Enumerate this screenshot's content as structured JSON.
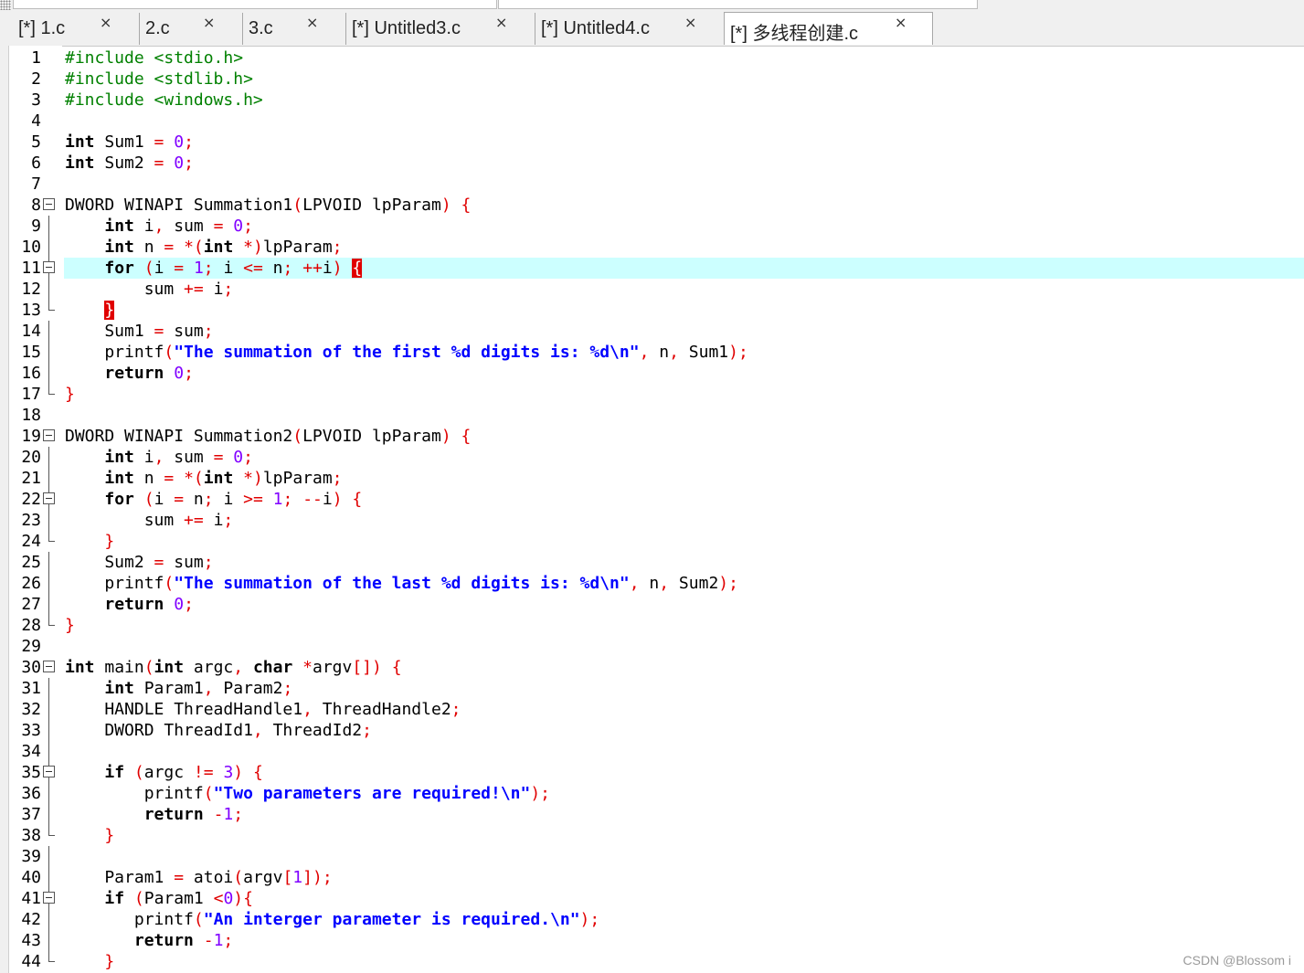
{
  "tabs": [
    {
      "label": "[*] 1.c",
      "active": false
    },
    {
      "label": "2.c",
      "active": false
    },
    {
      "label": "3.c",
      "active": false
    },
    {
      "label": "[*] Untitled3.c",
      "active": false
    },
    {
      "label": "[*] Untitled4.c",
      "active": false
    },
    {
      "label": "[*] 多线程创建.c",
      "active": true
    }
  ],
  "close_glyph": "×",
  "watermark": "CSDN @Blossom i",
  "current_line": 11,
  "code_lines": [
    {
      "n": "1",
      "fold": "",
      "tokens": [
        [
          "pre",
          "#include <stdio.h>"
        ]
      ]
    },
    {
      "n": "2",
      "fold": "",
      "tokens": [
        [
          "pre",
          "#include <stdlib.h>"
        ]
      ]
    },
    {
      "n": "3",
      "fold": "",
      "tokens": [
        [
          "pre",
          "#include <windows.h>"
        ]
      ]
    },
    {
      "n": "4",
      "fold": "",
      "tokens": []
    },
    {
      "n": "5",
      "fold": "",
      "tokens": [
        [
          "kw",
          "int"
        ],
        [
          "id",
          " Sum1 "
        ],
        [
          "op",
          "="
        ],
        [
          "id",
          " "
        ],
        [
          "num",
          "0"
        ],
        [
          "op",
          ";"
        ]
      ]
    },
    {
      "n": "6",
      "fold": "",
      "tokens": [
        [
          "kw",
          "int"
        ],
        [
          "id",
          " Sum2 "
        ],
        [
          "op",
          "="
        ],
        [
          "id",
          " "
        ],
        [
          "num",
          "0"
        ],
        [
          "op",
          ";"
        ]
      ]
    },
    {
      "n": "7",
      "fold": "",
      "tokens": []
    },
    {
      "n": "8",
      "fold": "box",
      "tokens": [
        [
          "id",
          "DWORD WINAPI Summation1"
        ],
        [
          "op",
          "("
        ],
        [
          "id",
          "LPVOID lpParam"
        ],
        [
          "op",
          ")"
        ],
        [
          "id",
          " "
        ],
        [
          "brace",
          "{"
        ]
      ]
    },
    {
      "n": "9",
      "fold": "line",
      "tokens": [
        [
          "id",
          "    "
        ],
        [
          "kw",
          "int"
        ],
        [
          "id",
          " i"
        ],
        [
          "op",
          ","
        ],
        [
          "id",
          " sum "
        ],
        [
          "op",
          "="
        ],
        [
          "id",
          " "
        ],
        [
          "num",
          "0"
        ],
        [
          "op",
          ";"
        ]
      ]
    },
    {
      "n": "10",
      "fold": "line",
      "tokens": [
        [
          "id",
          "    "
        ],
        [
          "kw",
          "int"
        ],
        [
          "id",
          " n "
        ],
        [
          "op",
          "="
        ],
        [
          "id",
          " "
        ],
        [
          "op",
          "*("
        ],
        [
          "kw",
          "int"
        ],
        [
          "id",
          " "
        ],
        [
          "op",
          "*)"
        ],
        [
          "id",
          "lpParam"
        ],
        [
          "op",
          ";"
        ]
      ]
    },
    {
      "n": "11",
      "fold": "box",
      "tokens": [
        [
          "id",
          "    "
        ],
        [
          "kw",
          "for"
        ],
        [
          "id",
          " "
        ],
        [
          "op",
          "("
        ],
        [
          "id",
          "i "
        ],
        [
          "op",
          "="
        ],
        [
          "id",
          " "
        ],
        [
          "num",
          "1"
        ],
        [
          "op",
          ";"
        ],
        [
          "id",
          " i "
        ],
        [
          "op",
          "<="
        ],
        [
          "id",
          " n"
        ],
        [
          "op",
          ";"
        ],
        [
          "id",
          " "
        ],
        [
          "op",
          "++"
        ],
        [
          "id",
          "i"
        ],
        [
          "op",
          ")"
        ],
        [
          "id",
          " "
        ],
        [
          "bmatch",
          "{"
        ]
      ]
    },
    {
      "n": "12",
      "fold": "line",
      "tokens": [
        [
          "id",
          "        sum "
        ],
        [
          "op",
          "+="
        ],
        [
          "id",
          " i"
        ],
        [
          "op",
          ";"
        ]
      ]
    },
    {
      "n": "13",
      "fold": "end",
      "tokens": [
        [
          "id",
          "    "
        ],
        [
          "bmatch",
          "}"
        ]
      ]
    },
    {
      "n": "14",
      "fold": "line",
      "tokens": [
        [
          "id",
          "    Sum1 "
        ],
        [
          "op",
          "="
        ],
        [
          "id",
          " sum"
        ],
        [
          "op",
          ";"
        ]
      ]
    },
    {
      "n": "15",
      "fold": "line",
      "tokens": [
        [
          "id",
          "    printf"
        ],
        [
          "op",
          "("
        ],
        [
          "str",
          "\"The summation of the first %d digits is: %d\\n\""
        ],
        [
          "op",
          ","
        ],
        [
          "id",
          " n"
        ],
        [
          "op",
          ","
        ],
        [
          "id",
          " Sum1"
        ],
        [
          "op",
          ");"
        ]
      ]
    },
    {
      "n": "16",
      "fold": "line",
      "tokens": [
        [
          "id",
          "    "
        ],
        [
          "kw",
          "return"
        ],
        [
          "id",
          " "
        ],
        [
          "num",
          "0"
        ],
        [
          "op",
          ";"
        ]
      ]
    },
    {
      "n": "17",
      "fold": "end",
      "tokens": [
        [
          "brace",
          "}"
        ]
      ]
    },
    {
      "n": "18",
      "fold": "",
      "tokens": []
    },
    {
      "n": "19",
      "fold": "box",
      "tokens": [
        [
          "id",
          "DWORD WINAPI Summation2"
        ],
        [
          "op",
          "("
        ],
        [
          "id",
          "LPVOID lpParam"
        ],
        [
          "op",
          ")"
        ],
        [
          "id",
          " "
        ],
        [
          "brace",
          "{"
        ]
      ]
    },
    {
      "n": "20",
      "fold": "line",
      "tokens": [
        [
          "id",
          "    "
        ],
        [
          "kw",
          "int"
        ],
        [
          "id",
          " i"
        ],
        [
          "op",
          ","
        ],
        [
          "id",
          " sum "
        ],
        [
          "op",
          "="
        ],
        [
          "id",
          " "
        ],
        [
          "num",
          "0"
        ],
        [
          "op",
          ";"
        ]
      ]
    },
    {
      "n": "21",
      "fold": "line",
      "tokens": [
        [
          "id",
          "    "
        ],
        [
          "kw",
          "int"
        ],
        [
          "id",
          " n "
        ],
        [
          "op",
          "="
        ],
        [
          "id",
          " "
        ],
        [
          "op",
          "*("
        ],
        [
          "kw",
          "int"
        ],
        [
          "id",
          " "
        ],
        [
          "op",
          "*)"
        ],
        [
          "id",
          "lpParam"
        ],
        [
          "op",
          ";"
        ]
      ]
    },
    {
      "n": "22",
      "fold": "box",
      "tokens": [
        [
          "id",
          "    "
        ],
        [
          "kw",
          "for"
        ],
        [
          "id",
          " "
        ],
        [
          "op",
          "("
        ],
        [
          "id",
          "i "
        ],
        [
          "op",
          "="
        ],
        [
          "id",
          " n"
        ],
        [
          "op",
          ";"
        ],
        [
          "id",
          " i "
        ],
        [
          "op",
          ">="
        ],
        [
          "id",
          " "
        ],
        [
          "num",
          "1"
        ],
        [
          "op",
          ";"
        ],
        [
          "id",
          " "
        ],
        [
          "op",
          "--"
        ],
        [
          "id",
          "i"
        ],
        [
          "op",
          ")"
        ],
        [
          "id",
          " "
        ],
        [
          "brace",
          "{"
        ]
      ]
    },
    {
      "n": "23",
      "fold": "line",
      "tokens": [
        [
          "id",
          "        sum "
        ],
        [
          "op",
          "+="
        ],
        [
          "id",
          " i"
        ],
        [
          "op",
          ";"
        ]
      ]
    },
    {
      "n": "24",
      "fold": "end",
      "tokens": [
        [
          "id",
          "    "
        ],
        [
          "brace",
          "}"
        ]
      ]
    },
    {
      "n": "25",
      "fold": "line",
      "tokens": [
        [
          "id",
          "    Sum2 "
        ],
        [
          "op",
          "="
        ],
        [
          "id",
          " sum"
        ],
        [
          "op",
          ";"
        ]
      ]
    },
    {
      "n": "26",
      "fold": "line",
      "tokens": [
        [
          "id",
          "    printf"
        ],
        [
          "op",
          "("
        ],
        [
          "str",
          "\"The summation of the last %d digits is: %d\\n\""
        ],
        [
          "op",
          ","
        ],
        [
          "id",
          " n"
        ],
        [
          "op",
          ","
        ],
        [
          "id",
          " Sum2"
        ],
        [
          "op",
          ");"
        ]
      ]
    },
    {
      "n": "27",
      "fold": "line",
      "tokens": [
        [
          "id",
          "    "
        ],
        [
          "kw",
          "return"
        ],
        [
          "id",
          " "
        ],
        [
          "num",
          "0"
        ],
        [
          "op",
          ";"
        ]
      ]
    },
    {
      "n": "28",
      "fold": "end",
      "tokens": [
        [
          "brace",
          "}"
        ]
      ]
    },
    {
      "n": "29",
      "fold": "",
      "tokens": []
    },
    {
      "n": "30",
      "fold": "box",
      "tokens": [
        [
          "kw",
          "int"
        ],
        [
          "id",
          " main"
        ],
        [
          "op",
          "("
        ],
        [
          "kw",
          "int"
        ],
        [
          "id",
          " argc"
        ],
        [
          "op",
          ","
        ],
        [
          "id",
          " "
        ],
        [
          "kw",
          "char"
        ],
        [
          "id",
          " "
        ],
        [
          "op",
          "*"
        ],
        [
          "id",
          "argv"
        ],
        [
          "op",
          "[])"
        ],
        [
          "id",
          " "
        ],
        [
          "brace",
          "{"
        ]
      ]
    },
    {
      "n": "31",
      "fold": "line",
      "tokens": [
        [
          "id",
          "    "
        ],
        [
          "kw",
          "int"
        ],
        [
          "id",
          " Param1"
        ],
        [
          "op",
          ","
        ],
        [
          "id",
          " Param2"
        ],
        [
          "op",
          ";"
        ]
      ]
    },
    {
      "n": "32",
      "fold": "line",
      "tokens": [
        [
          "id",
          "    HANDLE ThreadHandle1"
        ],
        [
          "op",
          ","
        ],
        [
          "id",
          " ThreadHandle2"
        ],
        [
          "op",
          ";"
        ]
      ]
    },
    {
      "n": "33",
      "fold": "line",
      "tokens": [
        [
          "id",
          "    DWORD ThreadId1"
        ],
        [
          "op",
          ","
        ],
        [
          "id",
          " ThreadId2"
        ],
        [
          "op",
          ";"
        ]
      ]
    },
    {
      "n": "34",
      "fold": "line",
      "tokens": []
    },
    {
      "n": "35",
      "fold": "box",
      "tokens": [
        [
          "id",
          "    "
        ],
        [
          "kw",
          "if"
        ],
        [
          "id",
          " "
        ],
        [
          "op",
          "("
        ],
        [
          "id",
          "argc "
        ],
        [
          "op",
          "!="
        ],
        [
          "id",
          " "
        ],
        [
          "num",
          "3"
        ],
        [
          "op",
          ")"
        ],
        [
          "id",
          " "
        ],
        [
          "brace",
          "{"
        ]
      ]
    },
    {
      "n": "36",
      "fold": "line",
      "tokens": [
        [
          "id",
          "        printf"
        ],
        [
          "op",
          "("
        ],
        [
          "str",
          "\"Two parameters are required!\\n\""
        ],
        [
          "op",
          ");"
        ]
      ]
    },
    {
      "n": "37",
      "fold": "line",
      "tokens": [
        [
          "id",
          "        "
        ],
        [
          "kw",
          "return"
        ],
        [
          "id",
          " "
        ],
        [
          "op",
          "-"
        ],
        [
          "num",
          "1"
        ],
        [
          "op",
          ";"
        ]
      ]
    },
    {
      "n": "38",
      "fold": "end",
      "tokens": [
        [
          "id",
          "    "
        ],
        [
          "brace",
          "}"
        ]
      ]
    },
    {
      "n": "39",
      "fold": "line",
      "tokens": []
    },
    {
      "n": "40",
      "fold": "line",
      "tokens": [
        [
          "id",
          "    Param1 "
        ],
        [
          "op",
          "="
        ],
        [
          "id",
          " atoi"
        ],
        [
          "op",
          "("
        ],
        [
          "id",
          "argv"
        ],
        [
          "op",
          "["
        ],
        [
          "num",
          "1"
        ],
        [
          "op",
          "]);"
        ]
      ]
    },
    {
      "n": "41",
      "fold": "box",
      "tokens": [
        [
          "id",
          "    "
        ],
        [
          "kw",
          "if"
        ],
        [
          "id",
          " "
        ],
        [
          "op",
          "("
        ],
        [
          "id",
          "Param1 "
        ],
        [
          "op",
          "<"
        ],
        [
          "num",
          "0"
        ],
        [
          "op",
          "){"
        ]
      ]
    },
    {
      "n": "42",
      "fold": "line",
      "tokens": [
        [
          "id",
          "       printf"
        ],
        [
          "op",
          "("
        ],
        [
          "str",
          "\"An interger parameter is required.\\n\""
        ],
        [
          "op",
          ");"
        ]
      ]
    },
    {
      "n": "43",
      "fold": "line",
      "tokens": [
        [
          "id",
          "       "
        ],
        [
          "kw",
          "return"
        ],
        [
          "id",
          " "
        ],
        [
          "op",
          "-"
        ],
        [
          "num",
          "1"
        ],
        [
          "op",
          ";"
        ]
      ]
    },
    {
      "n": "44",
      "fold": "end",
      "tokens": [
        [
          "id",
          "    "
        ],
        [
          "brace",
          "}"
        ]
      ]
    }
  ]
}
